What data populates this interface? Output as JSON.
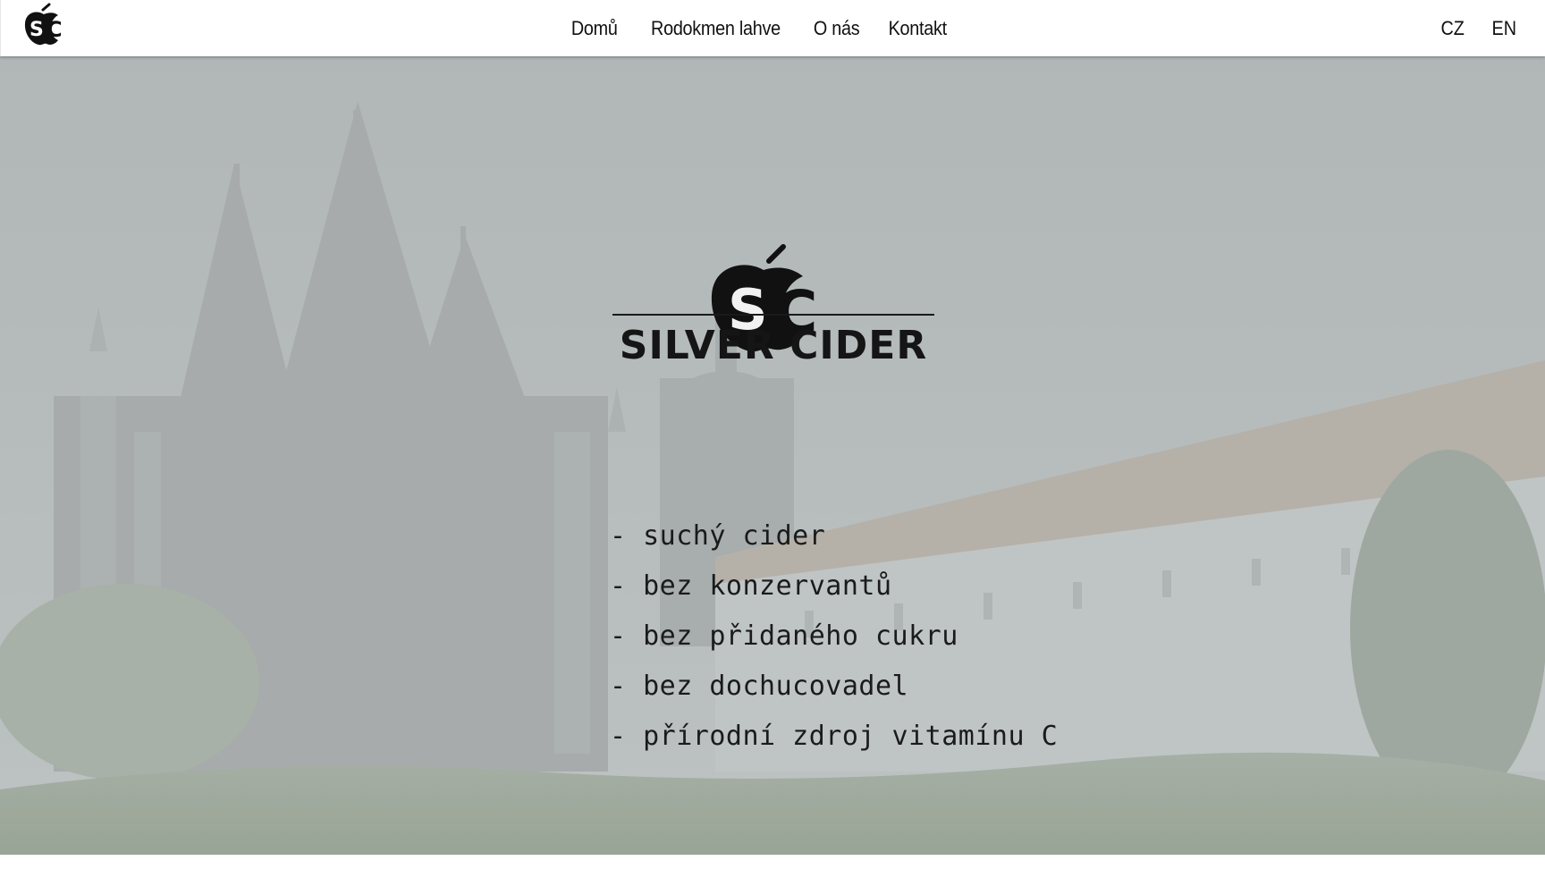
{
  "header": {
    "logo_text": "ŚC",
    "nav": [
      {
        "label": "Domů"
      },
      {
        "label": "Rodokmen lahve"
      },
      {
        "label": "O nás"
      },
      {
        "label": "Kontakt"
      }
    ],
    "languages": [
      {
        "label": "CZ"
      },
      {
        "label": "EN"
      }
    ]
  },
  "hero": {
    "logo_text": "ŚC",
    "brand": "SILVER CIDER",
    "features": [
      {
        "text": "- suchý cider"
      },
      {
        "text": "- bez konzervantů"
      },
      {
        "text": "- bez přidaného cukru"
      },
      {
        "text": "- bez dochucovadel"
      },
      {
        "text": "- přírodní zdroj vitamínu C"
      }
    ],
    "background": "Church of St. Barbara and Jesuit College, Kutná Hora",
    "colors": {
      "overlay": "#c8cccc",
      "text": "#151515"
    }
  }
}
